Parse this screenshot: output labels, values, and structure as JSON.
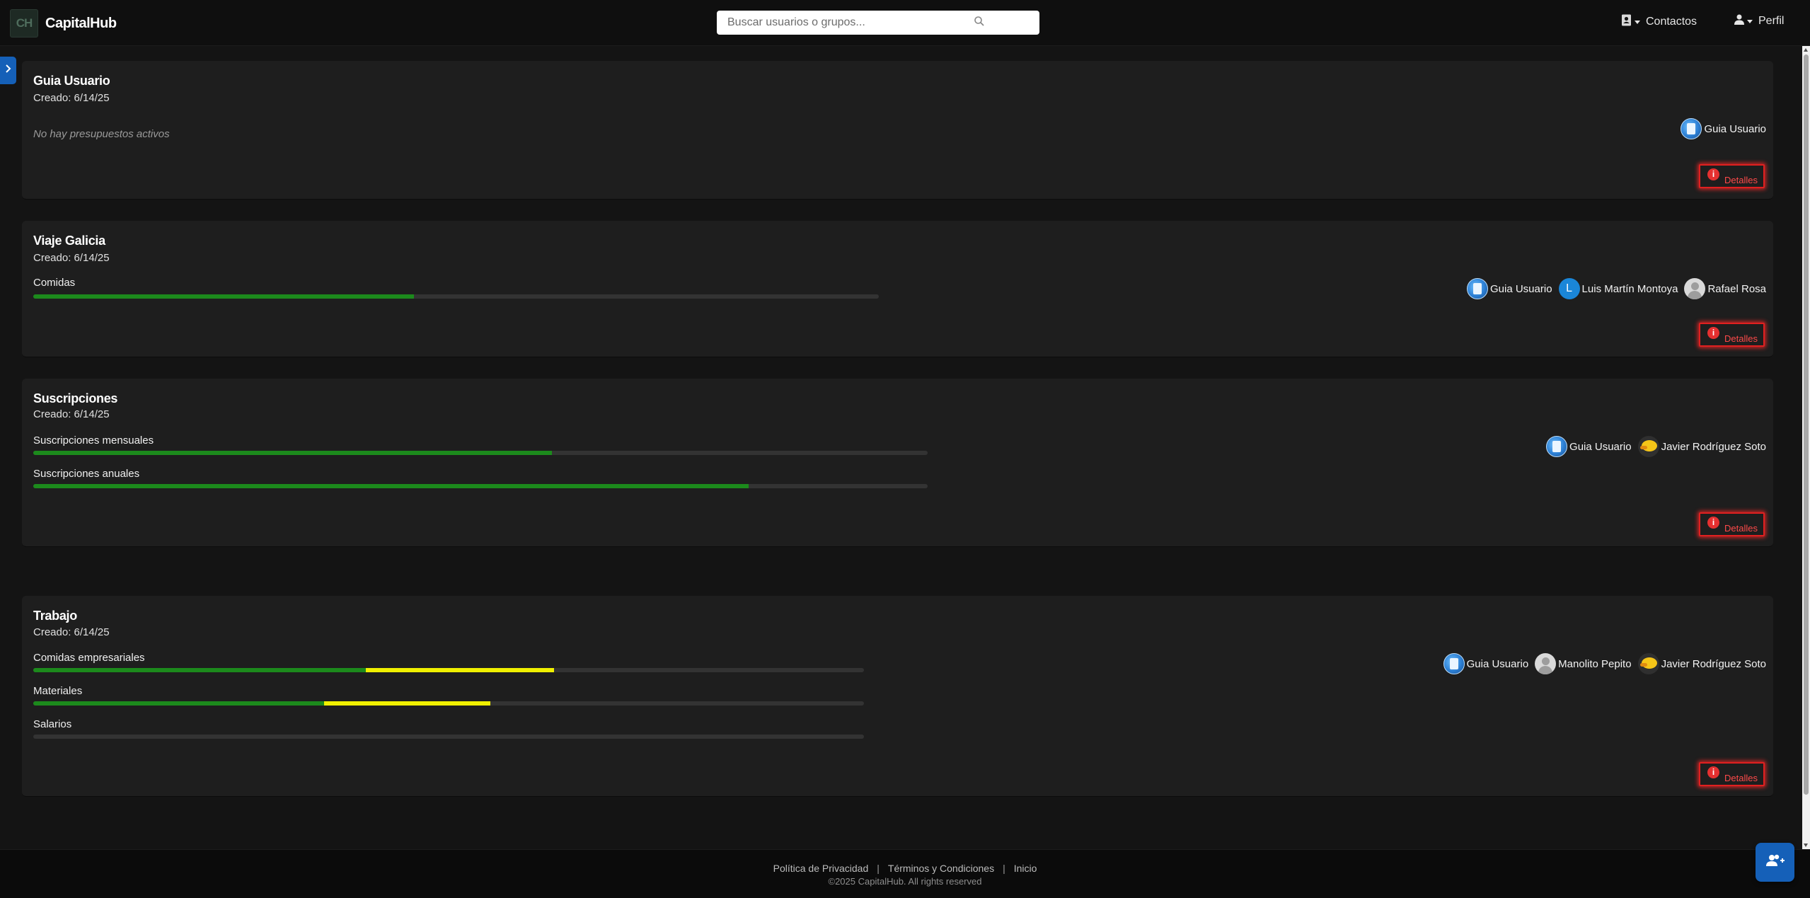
{
  "navbar": {
    "logo_text": "CH",
    "brand": "CapitalHub",
    "search_placeholder": "Buscar usuarios o grupos...",
    "contacts_label": "Contactos",
    "profile_label": "Perfil"
  },
  "groups": [
    {
      "title": "Guia Usuario",
      "created": "Creado: 6/14/25",
      "empty_note": "No hay presupuestos activos",
      "budgets": [],
      "members": [
        {
          "name": "Guia Usuario",
          "avatar": "globe-avatar"
        }
      ],
      "details_label": "Detalles"
    },
    {
      "title": "Viaje Galicia",
      "created": "Creado: 6/14/25",
      "budgets": [
        {
          "name": "Comidas",
          "green": 0.45,
          "yellow": 0
        }
      ],
      "members": [
        {
          "name": "Guia Usuario",
          "avatar": "globe-avatar"
        },
        {
          "name": "Luis Martín Montoya",
          "avatar": "letter-avatar",
          "initial": "L"
        },
        {
          "name": "Rafael Rosa",
          "avatar": "default-avatar"
        }
      ],
      "details_label": "Detalles"
    },
    {
      "title": "Suscripciones",
      "created": "Creado: 6/14/25",
      "budgets": [
        {
          "name": "Suscripciones mensuales",
          "green": 0.58,
          "yellow": 0
        },
        {
          "name": "Suscripciones anuales",
          "green": 0.8,
          "yellow": 0
        }
      ],
      "members": [
        {
          "name": "Guia Usuario",
          "avatar": "globe-avatar"
        },
        {
          "name": "Javier Rodríguez Soto",
          "avatar": "duck-avatar"
        }
      ],
      "details_label": "Detalles"
    },
    {
      "title": "Trabajo",
      "created": "Creado: 6/14/25",
      "budgets": [
        {
          "name": "Comidas empresariales",
          "green": 0.4,
          "yellow": 0.227
        },
        {
          "name": "Materiales",
          "green": 0.35,
          "yellow": 0.2
        },
        {
          "name": "Salarios",
          "green": 0,
          "yellow": 0
        }
      ],
      "members": [
        {
          "name": "Guia Usuario",
          "avatar": "globe-avatar"
        },
        {
          "name": "Manolito Pepito",
          "avatar": "default-avatar"
        },
        {
          "name": "Javier Rodríguez Soto",
          "avatar": "duck-avatar"
        }
      ],
      "details_label": "Detalles"
    }
  ],
  "footer": {
    "links": [
      "Política de Privacidad",
      "Términos y Condiciones",
      "Inicio"
    ],
    "separator": "|",
    "copyright": "©2025 CapitalHub. All rights reserved"
  },
  "colors": {
    "accent": "#1560b8",
    "progress_green": "#1c8a1c",
    "progress_yellow": "#f0f000",
    "details_red": "#e02020"
  }
}
